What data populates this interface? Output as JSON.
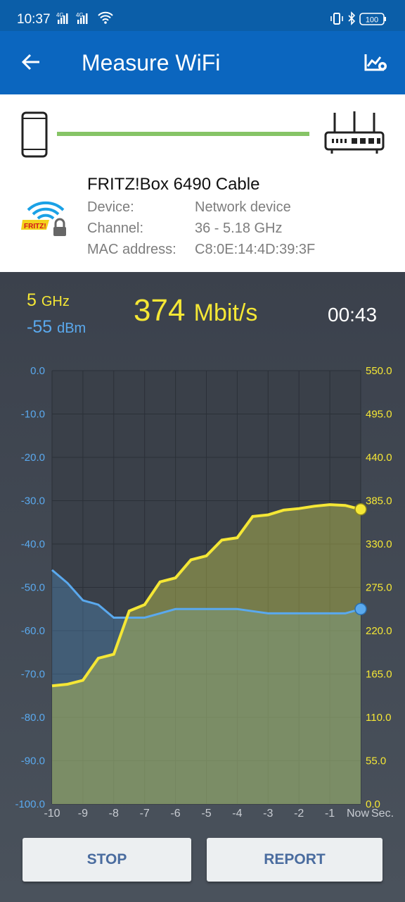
{
  "status_bar": {
    "time": "10:37",
    "net1": "4G",
    "net2": "4G",
    "battery": "100"
  },
  "app_bar": {
    "title": "Measure WiFi"
  },
  "device": {
    "name": "FRITZ!Box 6490 Cable",
    "rows": [
      {
        "label": "Device:",
        "value": "Network device"
      },
      {
        "label": "Channel:",
        "value": "36 - 5.18 GHz"
      },
      {
        "label": "MAC address:",
        "value": "C8:0E:14:4D:39:3F"
      }
    ],
    "logo_text": "FRITZ!"
  },
  "live": {
    "band": "5",
    "band_unit": "GHz",
    "signal": "-55",
    "signal_unit": "dBm",
    "speed": "374",
    "speed_unit": "Mbit/s",
    "elapsed": "00:43"
  },
  "chart_data": {
    "type": "line",
    "x_tick_labels": [
      "-10",
      "-9",
      "-8",
      "-7",
      "-6",
      "-5",
      "-4",
      "-3",
      "-2",
      "-1",
      "Now"
    ],
    "x_unit": "Sec.",
    "left_axis": {
      "ticks": [
        "0.0",
        "-10.0",
        "-20.0",
        "-30.0",
        "-40.0",
        "-50.0",
        "-60.0",
        "-70.0",
        "-80.0",
        "-90.0",
        "-100.0"
      ],
      "range": [
        -100,
        0
      ],
      "color": "#5aa9ee"
    },
    "right_axis": {
      "ticks": [
        "550.0",
        "495.0",
        "440.0",
        "385.0",
        "330.0",
        "275.0",
        "220.0",
        "165.0",
        "110.0",
        "55.0",
        "0.0"
      ],
      "range": [
        0,
        550
      ],
      "color": "#f5e735"
    },
    "series": [
      {
        "axis": "left",
        "color": "#5aa9ee",
        "x": [
          -10,
          -9.5,
          -9,
          -8.5,
          -8,
          -7.5,
          -7,
          -6.5,
          -6,
          -5.5,
          -5,
          -4.5,
          -4,
          -3.5,
          -3,
          -2.5,
          -2,
          -1.5,
          -1,
          -0.5,
          0
        ],
        "values": [
          -46,
          -49,
          -53,
          -54,
          -57,
          -57,
          -57,
          -56,
          -55,
          -55,
          -55,
          -55,
          -55,
          -55.5,
          -56,
          -56,
          -56,
          -56,
          -56,
          -56,
          -55
        ]
      },
      {
        "axis": "right",
        "color": "#f5e735",
        "x": [
          -10,
          -9.5,
          -9,
          -8.5,
          -8,
          -7.5,
          -7,
          -6.5,
          -6,
          -5.5,
          -5,
          -4.5,
          -4,
          -3.5,
          -3,
          -2.5,
          -2,
          -1.5,
          -1,
          -0.5,
          0
        ],
        "values": [
          150,
          152,
          157,
          185,
          190,
          245,
          253,
          282,
          287,
          310,
          315,
          335,
          338,
          365,
          367,
          373,
          375,
          378,
          380,
          379,
          374
        ]
      }
    ]
  },
  "buttons": {
    "stop": "STOP",
    "report": "REPORT"
  }
}
